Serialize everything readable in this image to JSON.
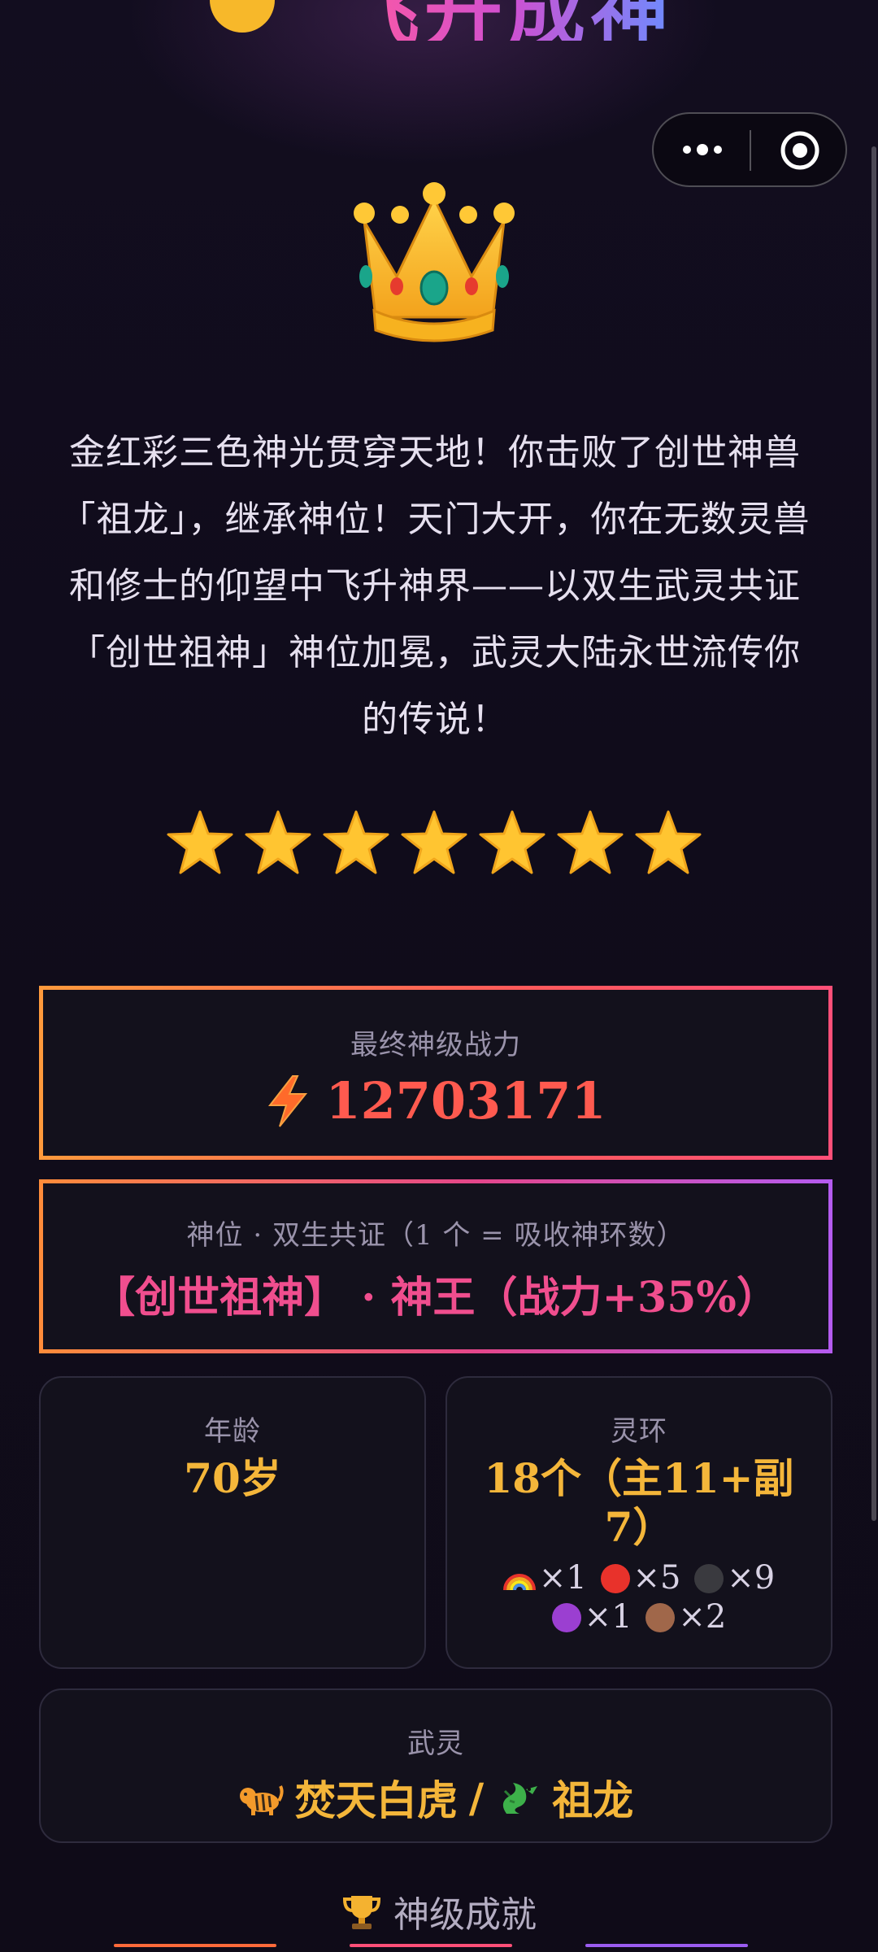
{
  "header": {
    "title": "飞升成神"
  },
  "capsule": {
    "more_icon": "more-dots-icon",
    "close_icon": "target-close-icon"
  },
  "hero": {
    "icon": "crown-icon",
    "story": "金红彩三色神光贯穿天地！你击败了创世神兽「祖龙」，继承神位！天门大开，你在无数灵兽和修士的仰望中飞升神界——以双生武灵共证「创世祖神」神位加冕，武灵大陆永世流传你的传说！",
    "stars": 7
  },
  "power": {
    "label": "最终神级战力",
    "value": "12703171",
    "icon": "lightning-icon"
  },
  "rank": {
    "label": "神位 · 双生共证（1 个 = 吸收神环数）",
    "value": "【创世祖神】 · 神王（战力+35%）"
  },
  "age": {
    "label": "年龄",
    "value": "70岁"
  },
  "rings": {
    "label": "灵环",
    "value": "18个（主11+副7）",
    "items": [
      {
        "icon": "rainbow-icon",
        "count": "×1"
      },
      {
        "icon": "red-circle-icon",
        "count": "×5",
        "color": "#e8322b"
      },
      {
        "icon": "black-circle-icon",
        "count": "×9",
        "color": "#3a3a3f"
      },
      {
        "icon": "purple-circle-icon",
        "count": "×1",
        "color": "#9b3fd1"
      },
      {
        "icon": "brown-circle-icon",
        "count": "×2",
        "color": "#a0674a"
      }
    ]
  },
  "spirit": {
    "label": "武灵",
    "first": "焚天白虎",
    "separator": "/",
    "second": "祖龙",
    "first_icon": "tiger-icon",
    "second_icon": "dragon-icon"
  },
  "achievements": {
    "title": "神级成就",
    "icon": "trophy-icon"
  },
  "colors": {
    "gold": "#f4b63a",
    "power_red": "#ff5a4f",
    "rank_pink": "#f04e8e"
  }
}
